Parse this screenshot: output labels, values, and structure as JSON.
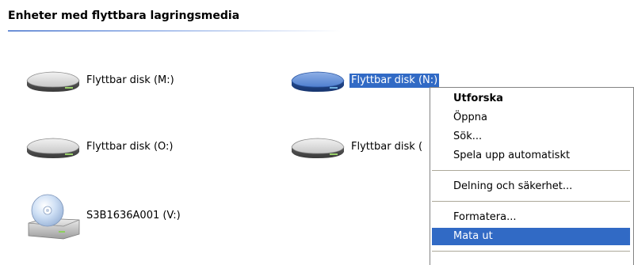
{
  "group": {
    "title": "Enheter med flyttbara lagringsmedia"
  },
  "drives": [
    {
      "label": "Flyttbar disk (M:)",
      "icon": "removable-disk-icon",
      "selected": false
    },
    {
      "label": "Flyttbar disk (N:)",
      "icon": "removable-disk-icon",
      "selected": true
    },
    {
      "label": "Flyttbar disk (O:)",
      "icon": "removable-disk-icon",
      "selected": false
    },
    {
      "label": "Flyttbar disk (",
      "icon": "removable-disk-icon",
      "selected": false
    },
    {
      "label": "S3B1636A001 (V:)",
      "icon": "cd-drive-icon",
      "selected": false
    }
  ],
  "context_menu": {
    "items": [
      {
        "label": "Utforska",
        "bold": true
      },
      {
        "label": "Öppna"
      },
      {
        "label": "Sök..."
      },
      {
        "label": "Spela upp automatiskt"
      },
      {
        "label": "Delning och säkerhet..."
      },
      {
        "label": "Formatera..."
      },
      {
        "label": "Mata ut",
        "highlighted": true
      }
    ]
  },
  "colors": {
    "selection": "#316ac5",
    "selected_drive_icon": "#3b6cc0",
    "drive_icon": "#b8b8b8",
    "menu_border": "#848484"
  }
}
